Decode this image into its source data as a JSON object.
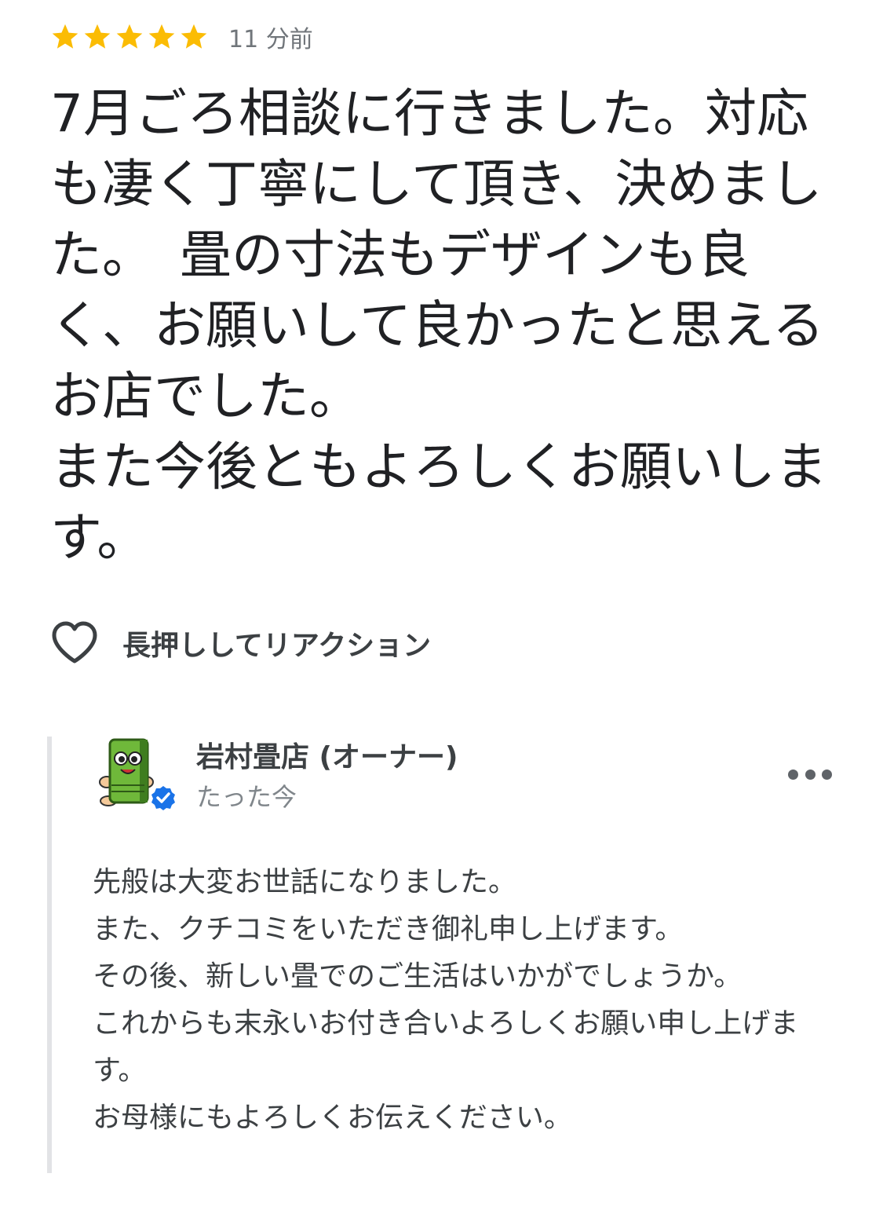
{
  "review": {
    "rating": 5,
    "max_rating": 5,
    "star_color": "#FBBC04",
    "time_ago": "11 分前",
    "text": "7月ごろ相談に行きました。対応も凄く丁寧にして頂き、決めました。　畳の寸法もデザインも良く、お願いして良かったと思えるお店でした。\nまた今後ともよろしくお願いします。"
  },
  "reaction": {
    "icon": "heart-outline-icon",
    "label": "長押ししてリアクション"
  },
  "owner_reply": {
    "name": "岩村畳店 (オーナー)",
    "time": "たった今",
    "avatar_icon": "tatami-mascot-avatar",
    "verified_icon": "verified-check-icon",
    "verified_color": "#1A73E8",
    "more_icon": "more-horizontal-icon",
    "text": "先般は大変お世話になりました。\nまた、クチコミをいただき御礼申し上げます。\nその後、新しい畳でのご生活はいかがでしょうか。\nこれからも末永いお付き合いよろしくお願い申し上げます。\nお母様にもよろしくお伝えください。"
  }
}
